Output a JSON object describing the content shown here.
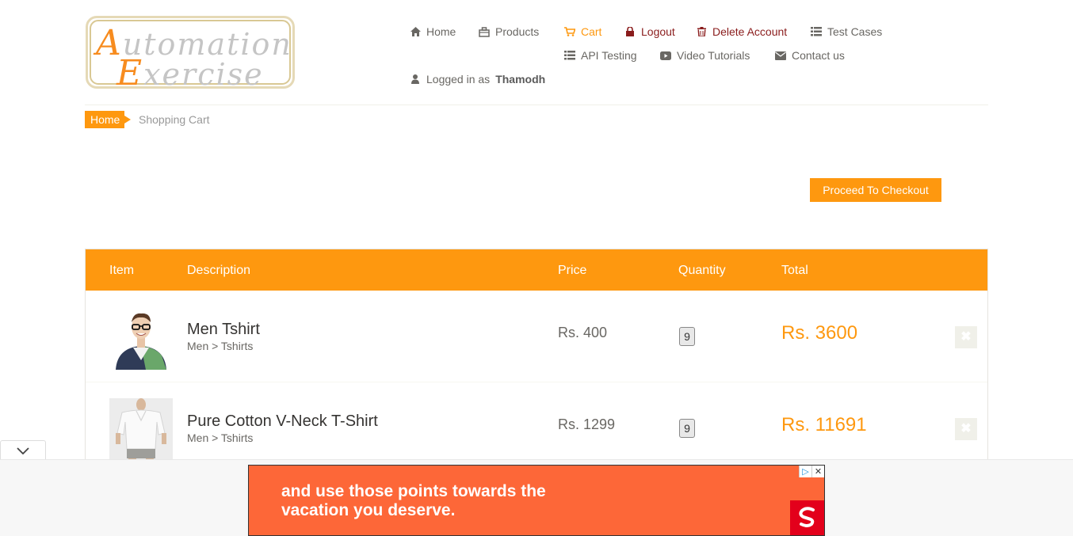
{
  "logo": {
    "line1_cap": "A",
    "line1_rest": "utomation",
    "line2_cap": "E",
    "line2_rest": "xercise"
  },
  "nav": {
    "home": "Home",
    "products": "Products",
    "cart": "Cart",
    "logout": "Logout",
    "delete_account": "Delete Account",
    "test_cases": "Test Cases",
    "api_testing": "API Testing",
    "video_tutorials": "Video Tutorials",
    "contact_us": "Contact us",
    "logged_in_prefix": "Logged in as",
    "username": "Thamodh"
  },
  "breadcrumb": {
    "home": "Home",
    "current": "Shopping Cart"
  },
  "checkout_label": "Proceed To Checkout",
  "table": {
    "headers": {
      "item": "Item",
      "description": "Description",
      "price": "Price",
      "quantity": "Quantity",
      "total": "Total"
    },
    "rows": [
      {
        "name": "Men Tshirt",
        "category": "Men > Tshirts",
        "price": "Rs. 400",
        "quantity": "9",
        "total": "Rs. 3600"
      },
      {
        "name": "Pure Cotton V-Neck T-Shirt",
        "category": "Men > Tshirts",
        "price": "Rs. 1299",
        "quantity": "9",
        "total": "Rs. 11691"
      }
    ]
  },
  "ad": {
    "text": "and use those points towards the\nvacation you deserve."
  },
  "colors": {
    "accent": "#fe980f",
    "danger": "#8a1c1c",
    "ad_bg": "#fd6738"
  }
}
